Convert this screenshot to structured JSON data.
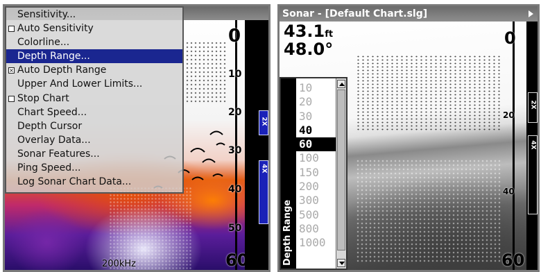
{
  "left_panel": {
    "menu": {
      "items": [
        {
          "label": "Sensitivity...",
          "checkbox": "none",
          "selected": false
        },
        {
          "label": "Auto Sensitivity",
          "checkbox": "unchecked",
          "selected": false
        },
        {
          "label": "Colorline...",
          "checkbox": "none",
          "selected": false
        },
        {
          "label": "Depth Range...",
          "checkbox": "none",
          "selected": true
        },
        {
          "label": "Auto Depth Range",
          "checkbox": "checked",
          "selected": false
        },
        {
          "label": "Upper And Lower Limits...",
          "checkbox": "none",
          "selected": false
        },
        {
          "label": "Stop Chart",
          "checkbox": "unchecked",
          "selected": false
        },
        {
          "label": "Chart Speed...",
          "checkbox": "none",
          "selected": false
        },
        {
          "label": "Depth Cursor",
          "checkbox": "none",
          "selected": false
        },
        {
          "label": "Overlay Data...",
          "checkbox": "none",
          "selected": false
        },
        {
          "label": "Sonar Features...",
          "checkbox": "none",
          "selected": false
        },
        {
          "label": "Ping Speed...",
          "checkbox": "none",
          "selected": false
        },
        {
          "label": "Log Sonar Chart Data...",
          "checkbox": "none",
          "selected": false
        }
      ]
    },
    "depth_scale": {
      "top": "0",
      "marks": [
        "10",
        "20",
        "30",
        "40",
        "50"
      ],
      "bottom": "60"
    },
    "zoom_tabs": [
      "2X",
      "4X"
    ],
    "frequency": "200kHz",
    "accent_color": "#1a2690"
  },
  "right_panel": {
    "title": "Sonar - [Default Chart.slg]",
    "depth_readout": "43.1",
    "depth_unit": "ft",
    "temperature": "48.0°",
    "depth_scale": {
      "top": "0",
      "marks": [
        "20",
        "40"
      ],
      "bottom": "60"
    },
    "zoom_tabs": [
      "2X",
      "4X"
    ],
    "depth_range_dialog": {
      "label": "Depth Range",
      "options": [
        "10",
        "20",
        "30",
        "40",
        "60",
        "100",
        "150",
        "200",
        "300",
        "500",
        "800",
        "1000"
      ],
      "highlighted": [
        "40"
      ],
      "selected": "60"
    }
  }
}
